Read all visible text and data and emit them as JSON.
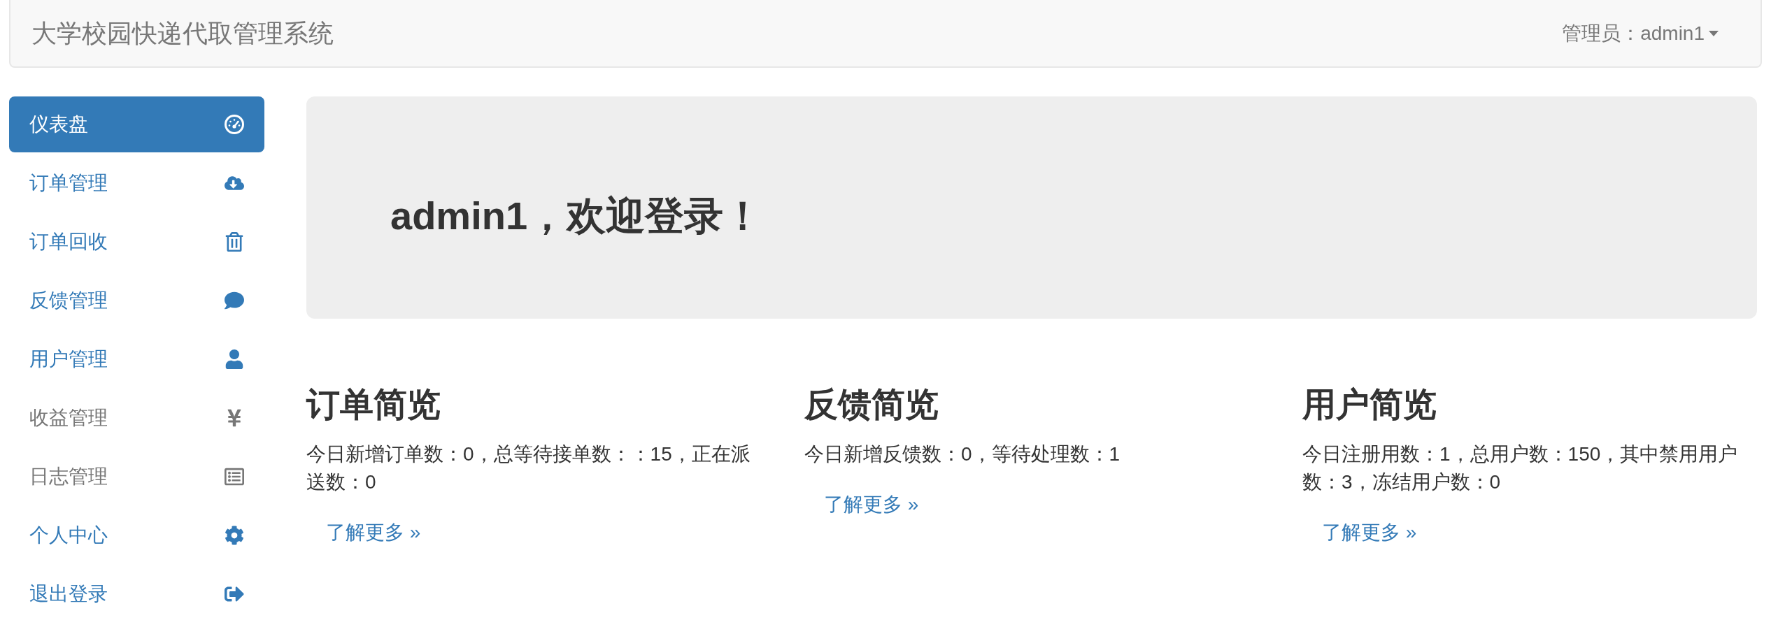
{
  "navbar": {
    "title": "大学校园快递代取管理系统",
    "user_menu": "管理员：admin1"
  },
  "sidebar": {
    "items": [
      {
        "label": "仪表盘",
        "selected": true,
        "disabled": false
      },
      {
        "label": "订单管理",
        "selected": false,
        "disabled": false
      },
      {
        "label": "订单回收",
        "selected": false,
        "disabled": false
      },
      {
        "label": "反馈管理",
        "selected": false,
        "disabled": false
      },
      {
        "label": "用户管理",
        "selected": false,
        "disabled": false
      },
      {
        "label": "收益管理",
        "selected": false,
        "disabled": true
      },
      {
        "label": "日志管理",
        "selected": false,
        "disabled": true
      },
      {
        "label": "个人中心",
        "selected": false,
        "disabled": false
      },
      {
        "label": "退出登录",
        "selected": false,
        "disabled": false
      }
    ]
  },
  "jumbotron": {
    "heading": "admin1，欢迎登录！"
  },
  "panels": [
    {
      "title": "订单简览",
      "text": "今日新增订单数：0，总等待接单数：：15，正在派送数：0",
      "link": "了解更多 »"
    },
    {
      "title": "反馈简览",
      "text": "今日新增反馈数：0，等待处理数：1",
      "link": "了解更多 »"
    },
    {
      "title": "用户简览",
      "text": "今日注册用数：1，总用户数：150，其中禁用用户数：3，冻结用户数：0",
      "link": "了解更多 »"
    }
  ]
}
